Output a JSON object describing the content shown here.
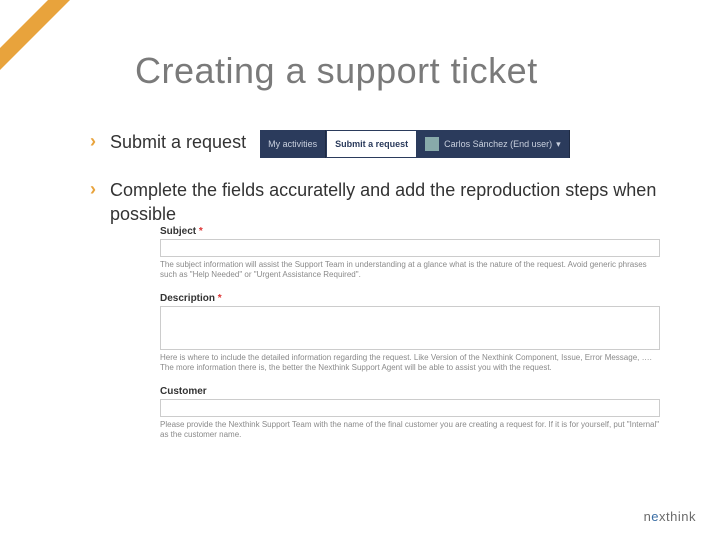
{
  "title": "Creating a support ticket",
  "bullets": {
    "b1": "Submit a request",
    "b2": "Complete the fields accuratelly and add the reproduction steps when possible"
  },
  "navbar": {
    "item1": "My activities",
    "item2": "Submit a request",
    "user": "Carlos Sánchez (End user)"
  },
  "form": {
    "subject": {
      "label": "Subject",
      "hint": "The subject information will assist the Support Team in understanding at a glance what is the nature of the request. Avoid generic phrases such as \"Help Needed\" or \"Urgent Assistance Required\"."
    },
    "description": {
      "label": "Description",
      "hint": "Here is where to include the detailed information regarding the request. Like Version of the Nexthink Component, Issue, Error Message, …. The more information there is, the better the Nexthink Support Agent will be able to assist you with the request."
    },
    "customer": {
      "label": "Customer",
      "hint": "Please provide the Nexthink Support Team with the name of the final customer you are creating a request for. If it is for yourself, put \"Internal\" as the customer name."
    }
  },
  "brand": {
    "pre": "n",
    "mid": "e",
    "post": "xthink"
  }
}
